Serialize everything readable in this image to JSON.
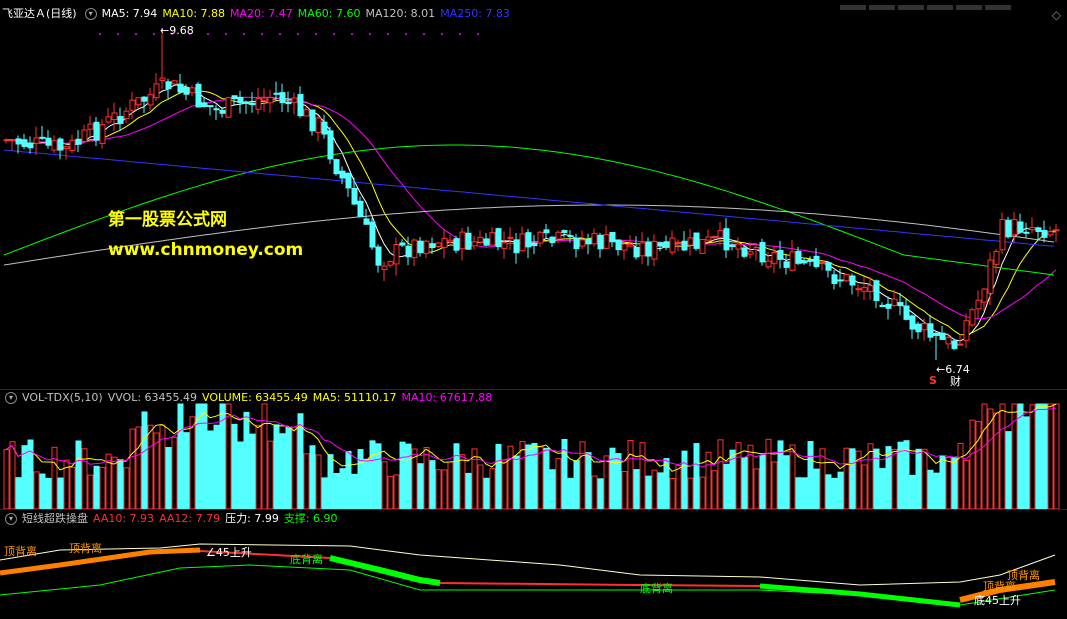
{
  "main": {
    "title": "飞亚达Ａ(日线)",
    "ma": [
      {
        "label": "MA5: 7.94",
        "color": "#ffffff"
      },
      {
        "label": "MA10: 7.88",
        "color": "#ffff00"
      },
      {
        "label": "MA20: 7.47",
        "color": "#ff00ff"
      },
      {
        "label": "MA60: 7.60",
        "color": "#00ff00"
      },
      {
        "label": "MA120: 8.01",
        "color": "#c0c0c0"
      },
      {
        "label": "MA250: 7.83",
        "color": "#3333ff"
      }
    ],
    "high_label": "9.68",
    "low_label": "6.74",
    "s_mark": "S",
    "cai_mark": "财",
    "watermark_title": "第一股票公式网",
    "watermark_url": "www.chnmoney.com"
  },
  "volume": {
    "name": "VOL-TDX(5,10)",
    "items": [
      {
        "label": "VVOL: 63455.49",
        "color": "#c0c0c0"
      },
      {
        "label": "VOLUME: 63455.49",
        "color": "#ffff00"
      },
      {
        "label": "MA5: 51110.17",
        "color": "#ffff00"
      },
      {
        "label": "MA10: 67617.88",
        "color": "#ff00ff"
      }
    ]
  },
  "indicator": {
    "name": "短线超跌操盘",
    "items": [
      {
        "label": "AA10: 7.93",
        "color": "#ff3030"
      },
      {
        "label": "AA12: 7.79",
        "color": "#ff3030"
      },
      {
        "label": "压力: 7.99",
        "color": "#ffffff"
      },
      {
        "label": "支撑: 6.90",
        "color": "#00ff00"
      }
    ],
    "texts": [
      {
        "id": "top1",
        "text": "顶背离",
        "color": "#ff9900"
      },
      {
        "id": "top2",
        "text": "顶背离",
        "color": "#ff9900"
      },
      {
        "id": "up45a",
        "text": "∠45上升",
        "color": "#ffffff"
      },
      {
        "id": "bottom1",
        "text": "底背离",
        "color": "#00ff00"
      },
      {
        "id": "bottom2",
        "text": "底背离",
        "color": "#00ff00"
      },
      {
        "id": "top3",
        "text": "顶背离",
        "color": "#ff9900"
      },
      {
        "id": "top4",
        "text": "顶背离",
        "color": "#ff9900"
      },
      {
        "id": "up45b",
        "text": "底45上升",
        "color": "#ffffff"
      }
    ]
  },
  "colors": {
    "up": "#ff3030",
    "down": "#54ffff",
    "separator": "#8b0000"
  }
}
